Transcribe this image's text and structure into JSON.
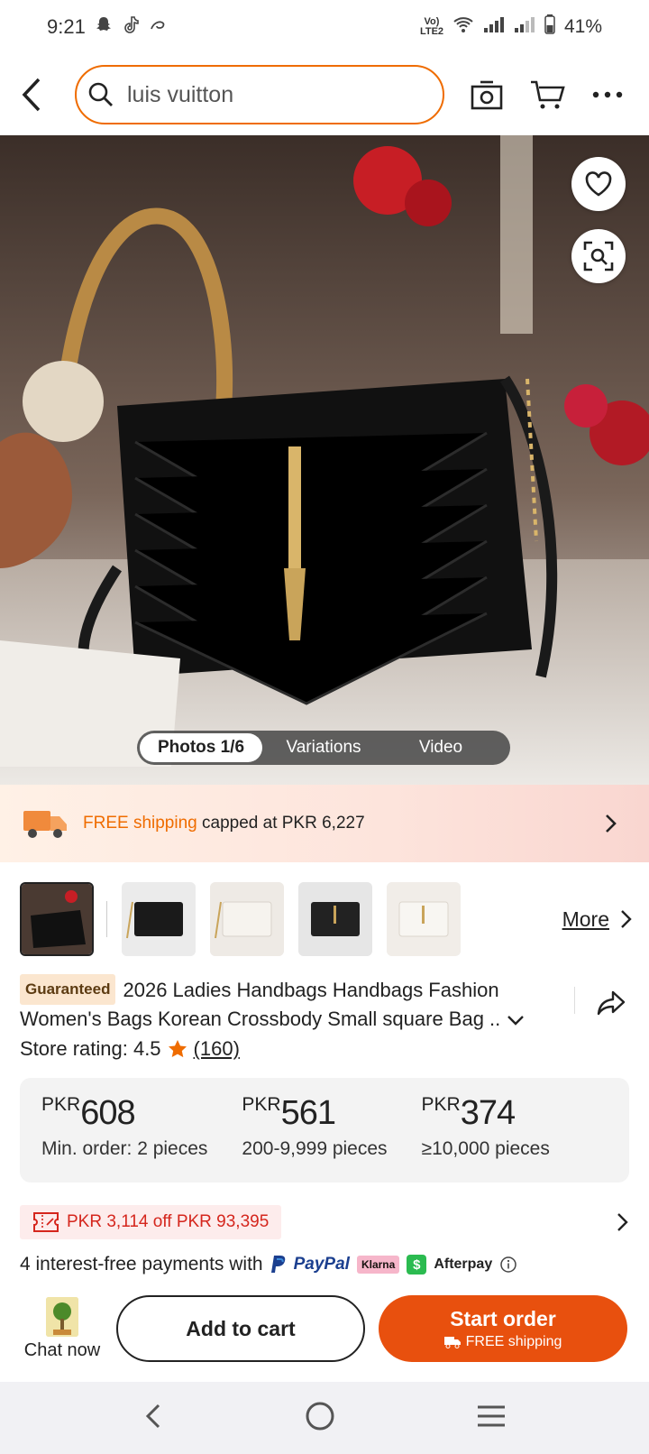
{
  "status_bar": {
    "time": "9:21",
    "network": "Vo) LTE2",
    "battery": "41%"
  },
  "search": {
    "query": "luis vuitton"
  },
  "media": {
    "tabs": [
      {
        "label": "Photos 1/6"
      },
      {
        "label": "Variations"
      },
      {
        "label": "Video"
      }
    ]
  },
  "shipping": {
    "free_label": "FREE shipping",
    "detail": "capped at PKR 6,227"
  },
  "thumbnails": {
    "more_label": "More"
  },
  "product": {
    "badge": "Guaranteed",
    "title": "2026 Ladies Handbags Handbags Fashion Women's Bags Korean Crossbody Small square Bag ..",
    "rating_label": "Store rating: 4.5",
    "rating_count": "(160)"
  },
  "prices": [
    {
      "currency": "PKR",
      "amount": "608",
      "tier": "Min. order: 2 pieces"
    },
    {
      "currency": "PKR",
      "amount": "561",
      "tier": "200-9,999 pieces"
    },
    {
      "currency": "PKR",
      "amount": "374",
      "tier": "≥10,000 pieces"
    }
  ],
  "coupon": {
    "text": "PKR 3,114 off PKR 93,395"
  },
  "payments": {
    "text": "4 interest-free payments with",
    "paypal": "PayPal",
    "klarna": "Klarna",
    "afterpay": "Afterpay"
  },
  "actions": {
    "chat_label": "Chat now",
    "add_cart_label": "Add to cart",
    "start_order_label": "Start order",
    "start_order_sub": "FREE shipping"
  },
  "colors": {
    "accent": "#e8500e",
    "search_border": "#ef6c00",
    "coupon_red": "#d5261d"
  }
}
